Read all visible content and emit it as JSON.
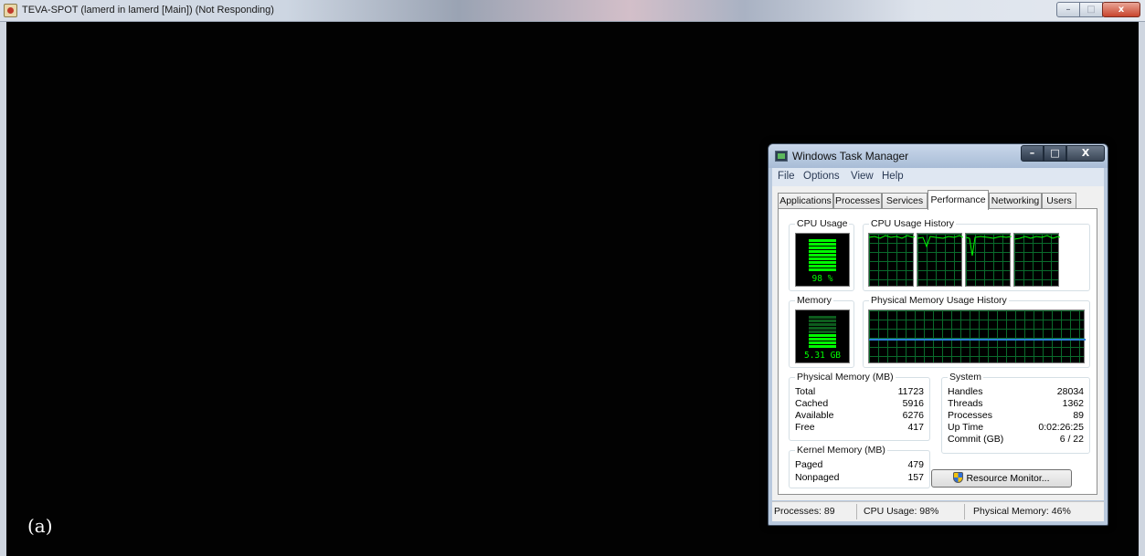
{
  "app": {
    "title": "TEVA-SPOT (lamerd in lamerd [Main]) (Not Responding)",
    "controls": {
      "minimize": "–",
      "maximize": "□",
      "close": "x"
    }
  },
  "figure_label": "(a)",
  "task_manager": {
    "title": "Windows Task Manager",
    "controls": {
      "minimize": "–",
      "maximize": "□",
      "close": "X"
    },
    "menu": [
      "File",
      "Options",
      "View",
      "Help"
    ],
    "tabs": [
      "Applications",
      "Processes",
      "Services",
      "Performance",
      "Networking",
      "Users"
    ],
    "active_tab": "Performance",
    "cpu_usage": {
      "label": "CPU Usage",
      "value": "98 %",
      "level": 0.98
    },
    "cpu_history": {
      "label": "CPU Usage History",
      "cores": 4
    },
    "memory": {
      "label": "Memory",
      "value": "5.31 GB",
      "level": 0.46
    },
    "memory_history": {
      "label": "Physical Memory Usage History"
    },
    "physical_memory": {
      "label": "Physical Memory (MB)",
      "rows": [
        {
          "key": "Total",
          "value": "11723"
        },
        {
          "key": "Cached",
          "value": "5916"
        },
        {
          "key": "Available",
          "value": "6276"
        },
        {
          "key": "Free",
          "value": "417"
        }
      ]
    },
    "kernel_memory": {
      "label": "Kernel Memory (MB)",
      "rows": [
        {
          "key": "Paged",
          "value": "479"
        },
        {
          "key": "Nonpaged",
          "value": "157"
        }
      ]
    },
    "system": {
      "label": "System",
      "rows": [
        {
          "key": "Handles",
          "value": "28034"
        },
        {
          "key": "Threads",
          "value": "1362"
        },
        {
          "key": "Processes",
          "value": "89"
        },
        {
          "key": "Up Time",
          "value": "0:02:26:25"
        },
        {
          "key": "Commit (GB)",
          "value": "6 / 22"
        }
      ]
    },
    "resource_monitor_button": "Resource Monitor...",
    "statusbar": {
      "processes": "Processes: 89",
      "cpu": "CPU Usage: 98%",
      "memory": "Physical Memory: 46%"
    },
    "colors": {
      "graph_line": "#00ff00",
      "grid": "#0a6b2c",
      "memory_line": "#2a7fd8"
    }
  }
}
